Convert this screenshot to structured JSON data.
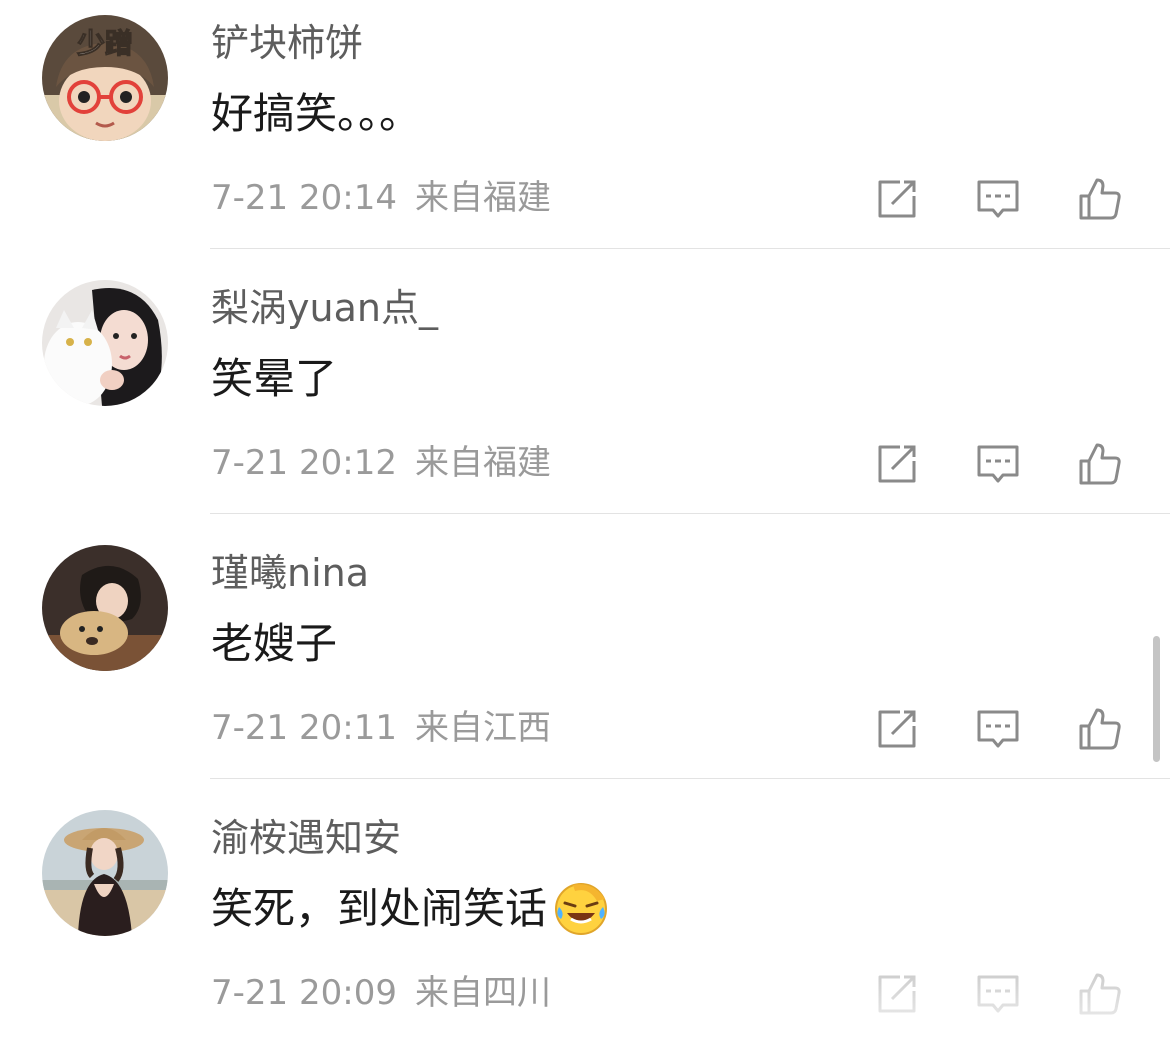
{
  "comments": [
    {
      "username": "铲块柿饼",
      "text": "好搞笑。。。",
      "time": "7-21 20:14",
      "location": "来自福建",
      "avatar_text": "少蹭"
    },
    {
      "username": "梨涡yuan点_",
      "text": "笑晕了",
      "time": "7-21 20:12",
      "location": "来自福建"
    },
    {
      "username": "瑾曦nina",
      "text": "老嫂子",
      "time": "7-21 20:11",
      "location": "来自江西"
    },
    {
      "username": "渝桉遇知安",
      "text": "笑死，到处闹笑话",
      "time": "7-21 20:09",
      "location": "来自四川",
      "emoji": "laughing-crying-emoji"
    }
  ],
  "icons": {
    "share": "share-icon",
    "reply": "comment-icon",
    "like": "thumbs-up-icon"
  },
  "colors": {
    "username": "#5d5d5d",
    "text": "#1a1a1a",
    "meta": "#9a9a9a",
    "icon": "#8a8a8a",
    "divider": "#e3e3e3"
  }
}
